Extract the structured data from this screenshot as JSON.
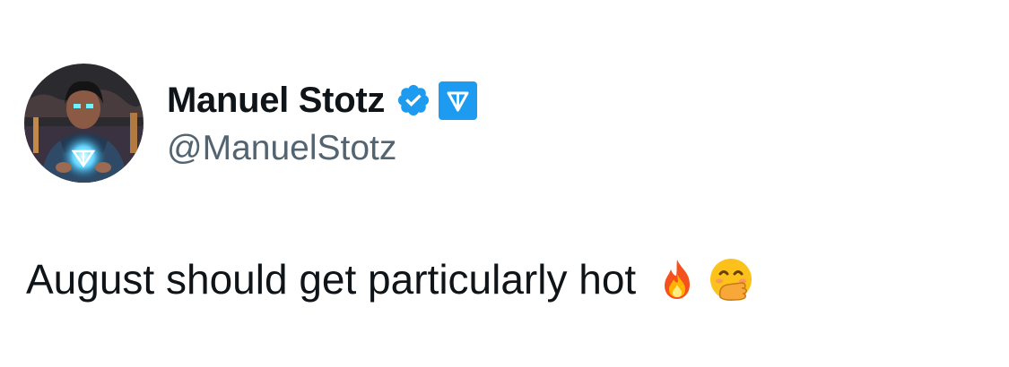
{
  "user": {
    "display_name": "Manuel Stotz",
    "handle": "@ManuelStotz",
    "verified_icon": "verified-check-icon",
    "affiliate_icon": "ton-logo-icon",
    "accent_color": "#1d9bf0"
  },
  "tweet": {
    "text": "August should get particularly hot",
    "emojis": [
      "fire-emoji",
      "hand-over-mouth-emoji"
    ]
  },
  "colors": {
    "text_primary": "#0f1419",
    "text_secondary": "#536471",
    "background": "#ffffff"
  }
}
